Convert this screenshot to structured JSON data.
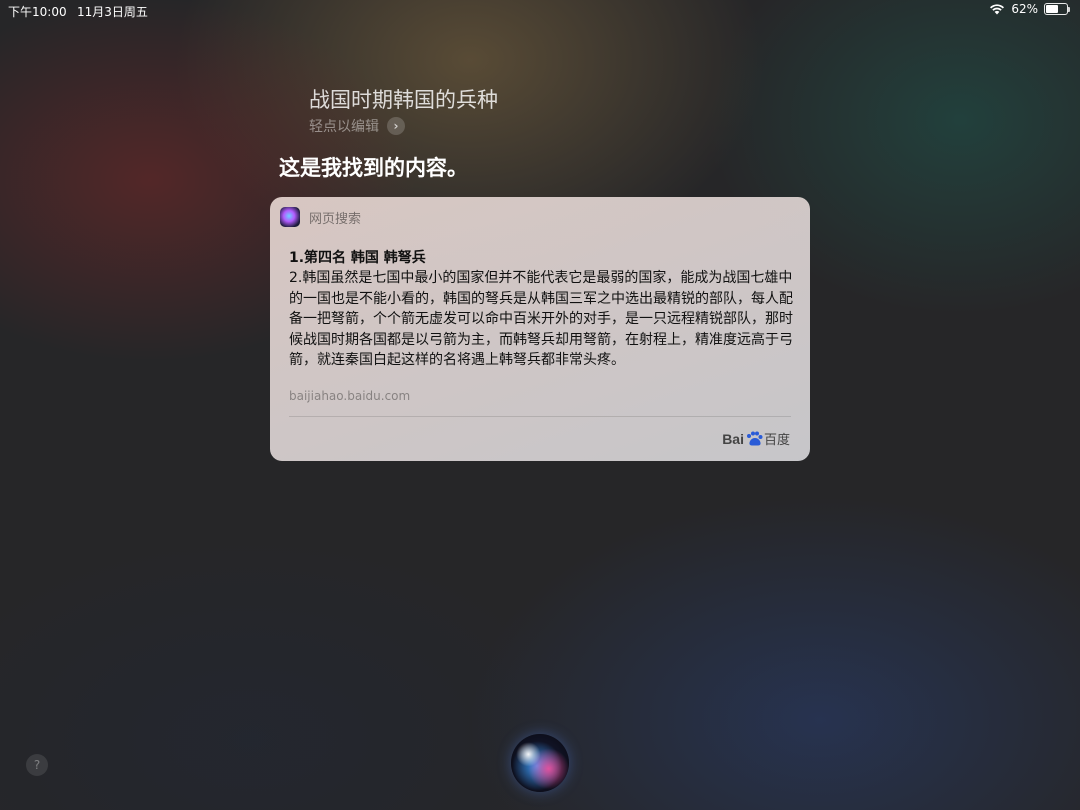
{
  "status_bar": {
    "time": "下午10:00",
    "date": "11月3日周五",
    "battery": "62%",
    "battery_level": 0.62
  },
  "query": {
    "text": "战国时期韩国的兵种",
    "edit_hint": "轻点以编辑"
  },
  "response": "这是我找到的内容。",
  "card": {
    "header": "网页搜索",
    "title": "1.第四名  韩国  韩弩兵",
    "body": "2.韩国虽然是七国中最小的国家但并不能代表它是最弱的国家，能成为战国七雄中的一国也是不能小看的，韩国的弩兵是从韩国三军之中选出最精锐的部队，每人配备一把弩箭，个个箭无虚发可以命中百米开外的对手，是一只远程精锐部队，那时候战国时期各国都是以弓箭为主，而韩弩兵却用弩箭，在射程上，精准度远高于弓箭，就连秦国白起这样的名将遇上韩弩兵都非常头疼。",
    "source": "baijiahao.baidu.com",
    "brand_latin": "Bai",
    "brand_cn": "百度"
  },
  "help": "?",
  "icons": [
    "wifi-icon",
    "battery-icon",
    "chevron-right-icon",
    "siri-app-icon",
    "paw-icon",
    "siri-orb"
  ]
}
